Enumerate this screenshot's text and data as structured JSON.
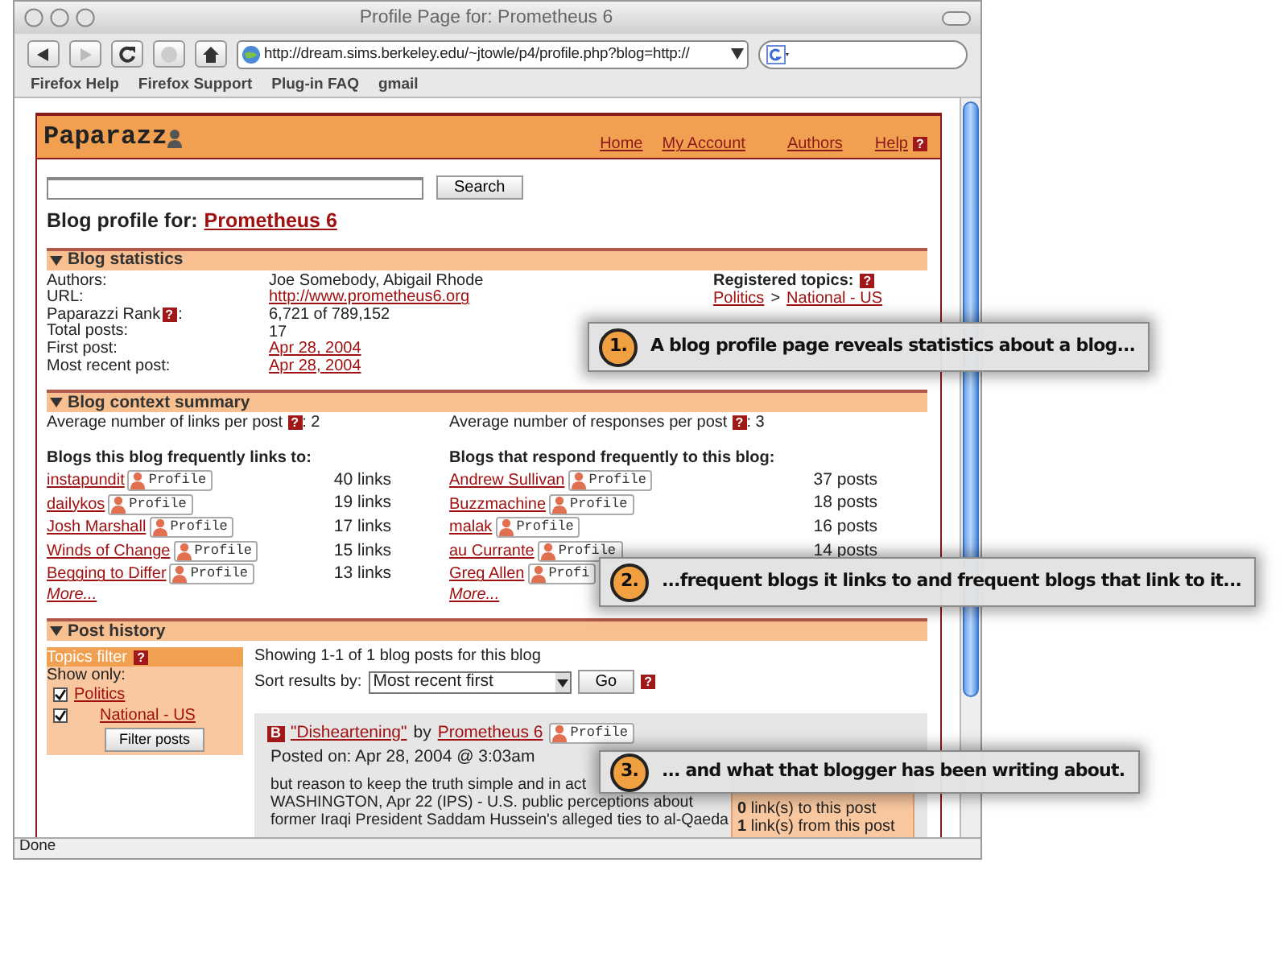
{
  "window": {
    "title": "Profile Page for: Prometheus 6"
  },
  "toolbar": {
    "url": "http://dream.sims.berkeley.edu/~jtowle/p4/profile.php?blog=http://"
  },
  "bookmarks": [
    "Firefox Help",
    "Firefox Support",
    "Plug-in FAQ",
    "gmail"
  ],
  "site": {
    "logo": "Paparazz",
    "nav": [
      {
        "label": "Home"
      },
      {
        "label": "My Account"
      },
      {
        "label": "Authors"
      },
      {
        "label": "Help",
        "help": "?"
      }
    ]
  },
  "search": {
    "button": "Search"
  },
  "heading": {
    "label": "Blog profile for:",
    "blog": "Prometheus 6"
  },
  "statistics": {
    "title": "Blog statistics",
    "expanded": true,
    "rows": [
      {
        "label": "Authors:",
        "value": "Joe Somebody, Abigail Rhode",
        "kind": "text"
      },
      {
        "label": "URL:",
        "value": "http://www.prometheus6.org",
        "kind": "link"
      },
      {
        "label": "Paparazzi Rank",
        "help": "?",
        "suffix": ":",
        "value": "6,721 of 789,152",
        "kind": "text"
      },
      {
        "label": "Total posts:",
        "value": "17",
        "kind": "text"
      },
      {
        "label": "First post:",
        "value": "Apr 28, 2004",
        "kind": "link"
      },
      {
        "label": "Most recent post:",
        "value": "Apr 28, 2004",
        "kind": "link"
      }
    ],
    "topics_label": "Registered topics:",
    "topics_help": "?",
    "topics": [
      "Politics",
      "National - US"
    ],
    "topics_separator": ">"
  },
  "context": {
    "title": "Blog context summary",
    "expanded": true,
    "averages": [
      {
        "label": "Average number of links per post",
        "help": "?",
        "value": ": 2"
      },
      {
        "label": "Average number of responses per post",
        "help": "?",
        "value": ": 3"
      }
    ],
    "lists": [
      {
        "title": "Blogs this blog frequently links to:",
        "more": "More...",
        "items": [
          {
            "name": "instapundit",
            "profile": "Profile",
            "count": "40 links"
          },
          {
            "name": "dailykos",
            "profile": "Profile",
            "count": "19 links"
          },
          {
            "name": "Josh Marshall",
            "profile": "Profile",
            "count": "17 links"
          },
          {
            "name": "Winds of Change",
            "profile": "Profile",
            "count": "15 links"
          },
          {
            "name": "Begging to Differ",
            "profile": "Profile",
            "count": "13 links"
          }
        ]
      },
      {
        "title": "Blogs that respond frequently to this blog:",
        "more": "More...",
        "items": [
          {
            "name": "Andrew Sullivan",
            "profile": "Profile",
            "count": "37 posts"
          },
          {
            "name": "Buzzmachine",
            "profile": "Profile",
            "count": "18 posts"
          },
          {
            "name": "malak",
            "profile": "Profile",
            "count": "16 posts"
          },
          {
            "name": "au Currante",
            "profile": "Profile",
            "count": "14 posts"
          },
          {
            "name": "Greg Allen",
            "profile": "Profi"
          }
        ]
      }
    ]
  },
  "post_history": {
    "title": "Post history",
    "expanded": true,
    "filter": {
      "title": "Topics filter",
      "help": "?",
      "show_only": "Show only:",
      "topics": [
        {
          "label": "Politics",
          "checked": true,
          "children": [
            {
              "label": "National - US",
              "checked": true
            }
          ]
        }
      ],
      "button": "Filter posts"
    },
    "summary": "Showing 1-1 of 1 blog posts for this blog",
    "sort_label": "Sort results by:",
    "sort_value": "Most recent first",
    "go": "Go",
    "sort_help": "?",
    "post": {
      "badge": "B",
      "title": "\"Disheartening\"",
      "by": "by",
      "author": "Prometheus 6",
      "profile": "Profile",
      "posted": "Posted on: Apr 28, 2004 @ 3:03am",
      "body": [
        "but reason to keep the truth simple and in act",
        "WASHINGTON, Apr 22 (IPS) - U.S. public perceptions about",
        "former Iraqi President Saddam Hussein's alleged ties to al-Qaeda"
      ],
      "side": [
        "**0** link(s) to this post",
        "**1** link(s) from this post"
      ]
    }
  },
  "status_bar": "Done",
  "callouts": [
    {
      "number": "1.",
      "text": "A blog profile page reveals statistics about a blog..."
    },
    {
      "number": "2.",
      "text": "...frequent blogs it links to and frequent blogs that link to it..."
    },
    {
      "number": "3.",
      "text": "... and what that blogger has been writing about."
    }
  ]
}
